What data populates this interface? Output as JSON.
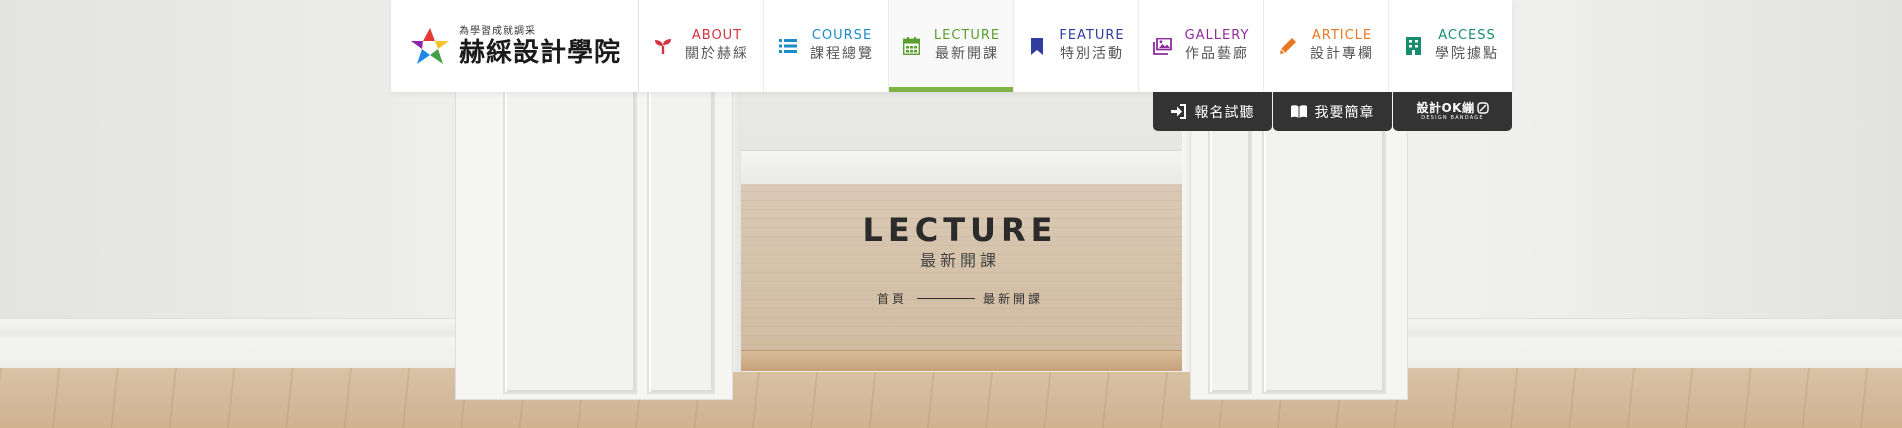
{
  "brand": {
    "tagline": "為學習成就調采",
    "name": "赫綵設計學院"
  },
  "nav": [
    {
      "en": "ABOUT",
      "zh": "關於赫綵",
      "color": "#d0343f",
      "icon": "sprout-icon"
    },
    {
      "en": "COURSE",
      "zh": "課程總覽",
      "color": "#1d8bc9",
      "icon": "list-icon"
    },
    {
      "en": "LECTURE",
      "zh": "最新開課",
      "color": "#5a9e2f",
      "icon": "calendar-icon",
      "active": true
    },
    {
      "en": "FEATURE",
      "zh": "特別活動",
      "color": "#2f3e9e",
      "icon": "bookmark-icon"
    },
    {
      "en": "GALLERY",
      "zh": "作品藝廊",
      "color": "#8e2c9c",
      "icon": "images-icon"
    },
    {
      "en": "ARTICLE",
      "zh": "設計專欄",
      "color": "#e87722",
      "icon": "pencil-icon"
    },
    {
      "en": "ACCESS",
      "zh": "學院據點",
      "color": "#1a8c6e",
      "icon": "building-icon"
    }
  ],
  "actions": {
    "signup": "報名試聽",
    "brochure": "我要簡章",
    "ok_main": "設計OK繃",
    "ok_sub": "DESIGN BANDAGE"
  },
  "hero": {
    "title": "LECTURE",
    "subtitle": "最新開課"
  },
  "breadcrumb": {
    "home": "首頁",
    "current": "最新開課"
  },
  "colors": {
    "active_underline": "#7cb342",
    "subbar_bg": "#333333"
  }
}
